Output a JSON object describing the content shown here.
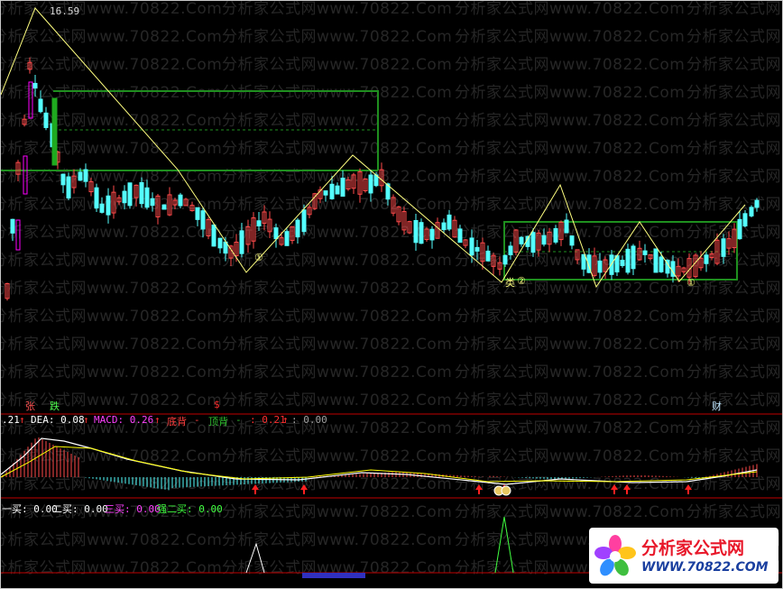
{
  "watermark": {
    "text": "分析家公式网www.70822.Com"
  },
  "main_panel": {
    "price_high_label": "16.59",
    "pattern_tag": "类",
    "circle_marks": [
      "①",
      "②",
      "①",
      "②"
    ],
    "signal_up": "张",
    "signal_down": "跌",
    "signal_money": "$",
    "signal_cai": "财"
  },
  "macd_header": {
    "value_prefix": ".21",
    "dea_label": "DEA: 0.08",
    "macd_label": "MACD: 0.26",
    "bottom_div_label": "底背",
    "bottom_div_value": "-",
    "top_div_label": "顶背",
    "top_div_value": "-",
    "val_a": ": 0.21",
    "val_b": ": 0.00"
  },
  "buy_header": {
    "buy1": "一买: 0.00",
    "buy2": "二买: 0.00",
    "buy3": "三买: 0.00",
    "strong_buy2": "强二买: 0.00"
  },
  "logo": {
    "cn": "分析家公式网",
    "url": "WWW.70822.COM"
  },
  "colors": {
    "background": "#000000",
    "up_candle": "#ff4a4a",
    "down_candle": "#54ffff",
    "zigzag": "#ffff80",
    "box": "#1f8f1f",
    "macd_dif": "#ffffff",
    "macd_dea": "#ffff00",
    "divider": "#c00000",
    "magenta": "#ff00ff",
    "buy_text": "#ffffff",
    "buy3_text": "#ff40ff",
    "strong_text": "#40ff40"
  }
}
